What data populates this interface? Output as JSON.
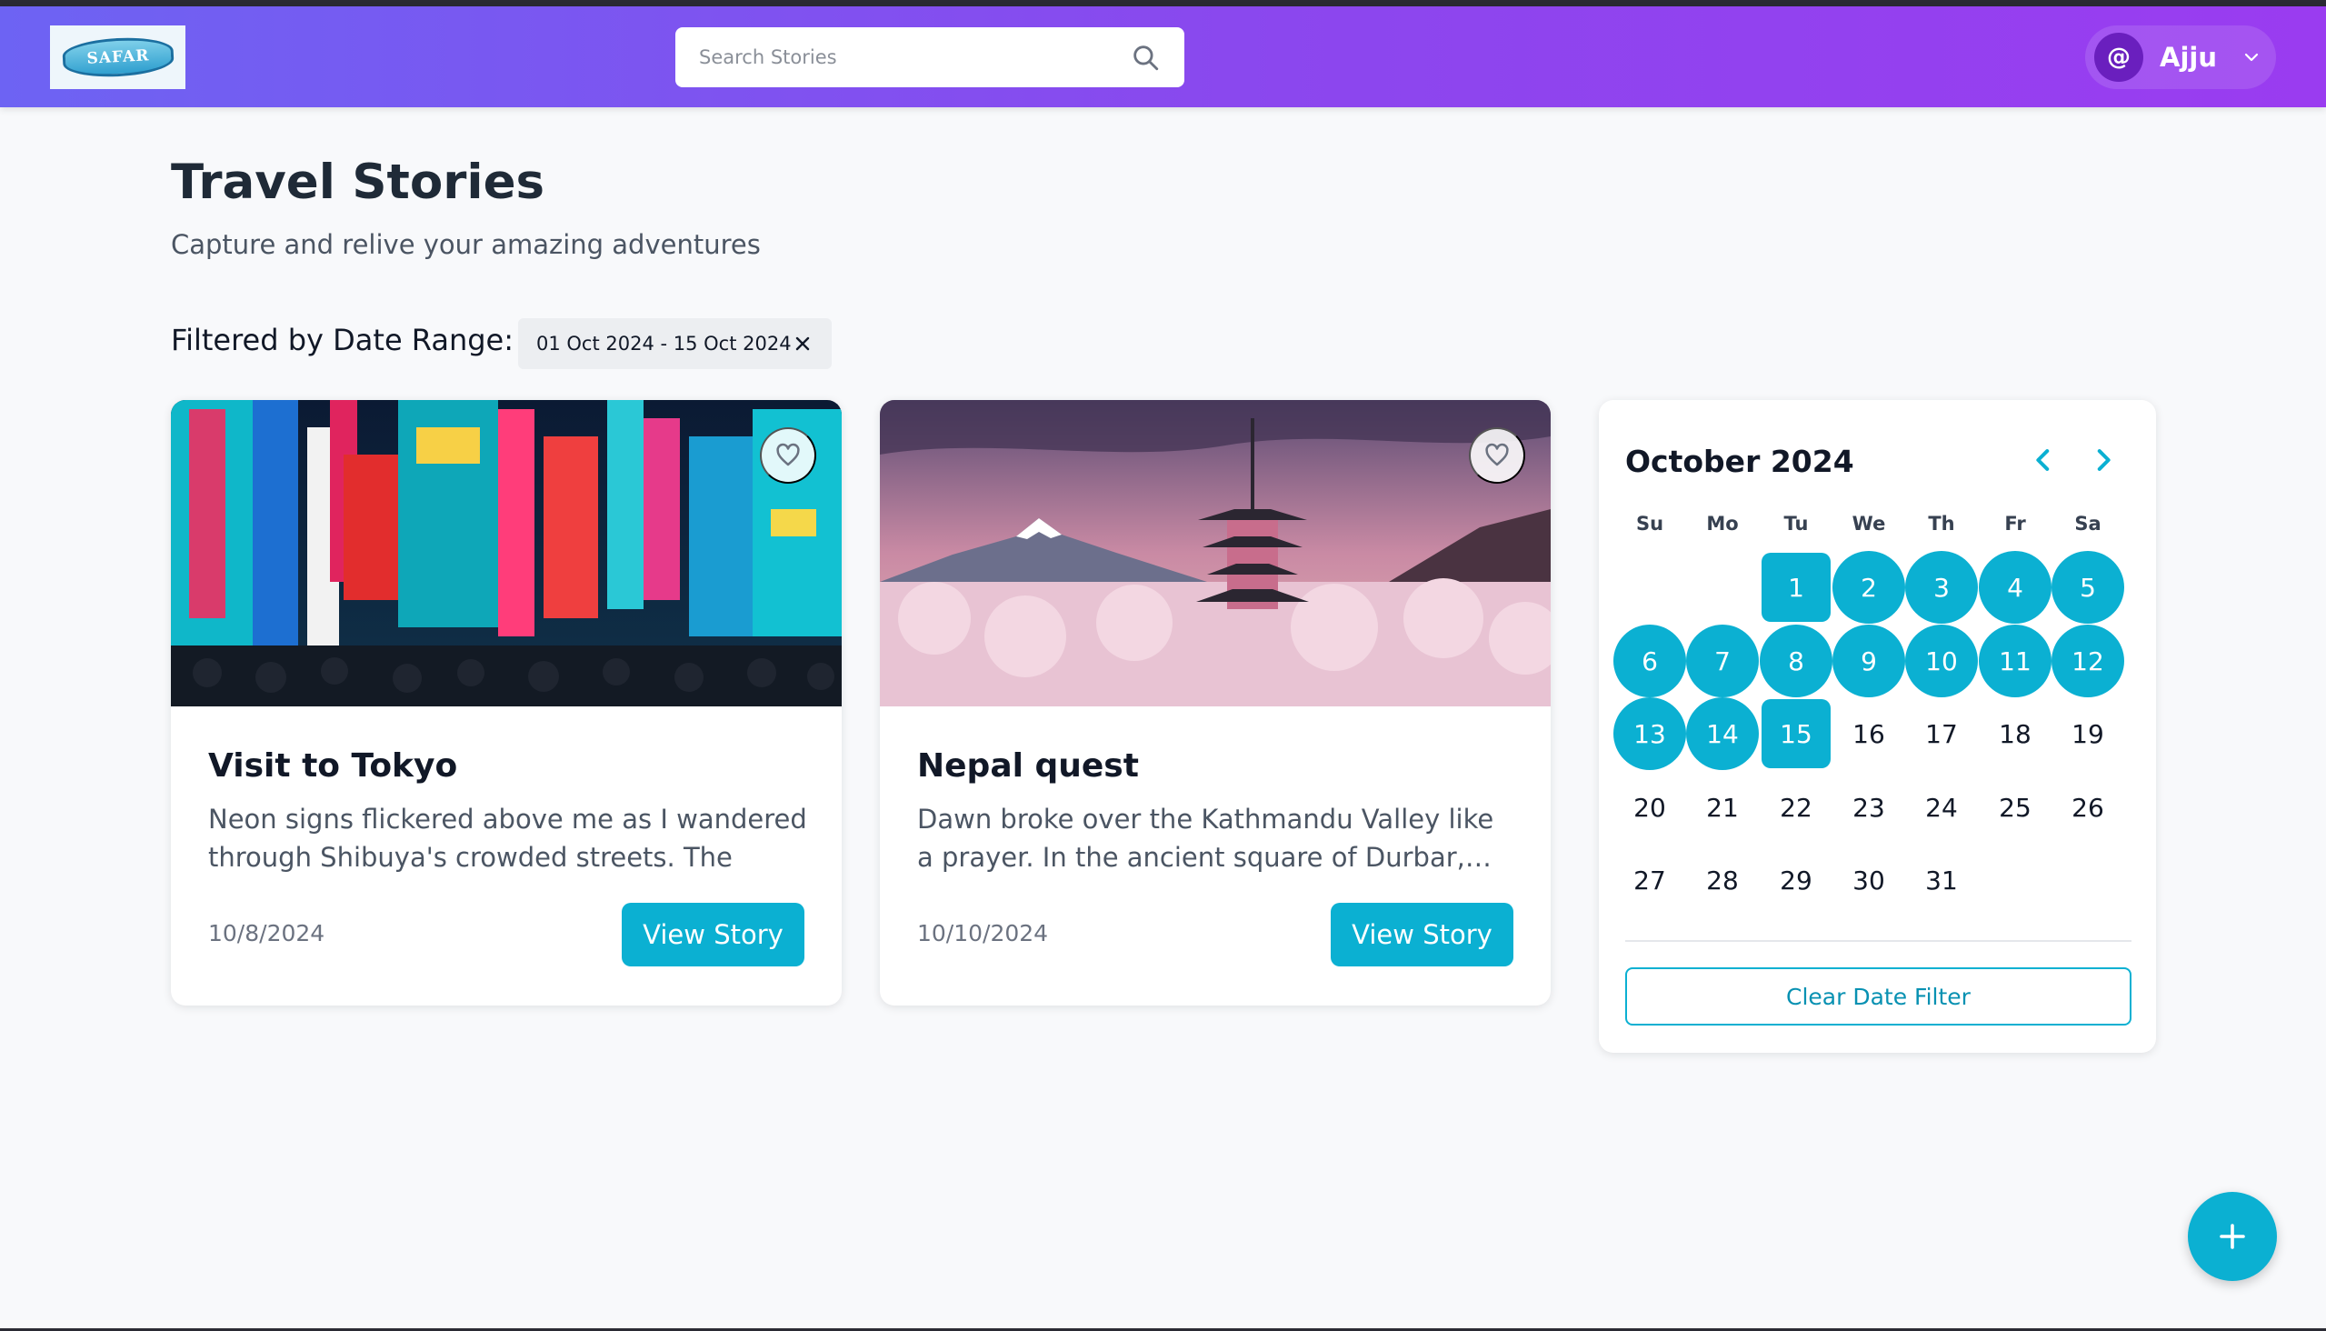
{
  "header": {
    "logo_text": "SAFAR",
    "search_placeholder": "Search Stories",
    "user_initial": "@",
    "user_name": "Ajju"
  },
  "page": {
    "title": "Travel Stories",
    "subtitle": "Capture and relive your amazing adventures"
  },
  "filter": {
    "label": "Filtered by Date Range:",
    "range": "01 Oct 2024 - 15 Oct 2024"
  },
  "stories": [
    {
      "title": "Visit to Tokyo",
      "excerpt": "Neon signs flickered above me as I wandered through Shibuya's crowded streets. The scent…",
      "date": "10/8/2024",
      "button": "View Story",
      "image": "tokyo-neon-street"
    },
    {
      "title": "Nepal quest",
      "excerpt": "Dawn broke over the Kathmandu Valley like a prayer. In the ancient square of Durbar,…",
      "date": "10/10/2024",
      "button": "View Story",
      "image": "pagoda-mountain-cherry-blossoms"
    }
  ],
  "calendar": {
    "month_label": "October 2024",
    "weekdays": [
      "Su",
      "Mo",
      "Tu",
      "We",
      "Th",
      "Fr",
      "Sa"
    ],
    "first_weekday_index": 2,
    "days_in_month": 31,
    "range_start": 1,
    "range_end": 15,
    "clear_label": "Clear Date Filter"
  },
  "colors": {
    "accent": "#0bb0d2",
    "header_start": "#6d63f3",
    "header_end": "#9a3cf0"
  }
}
